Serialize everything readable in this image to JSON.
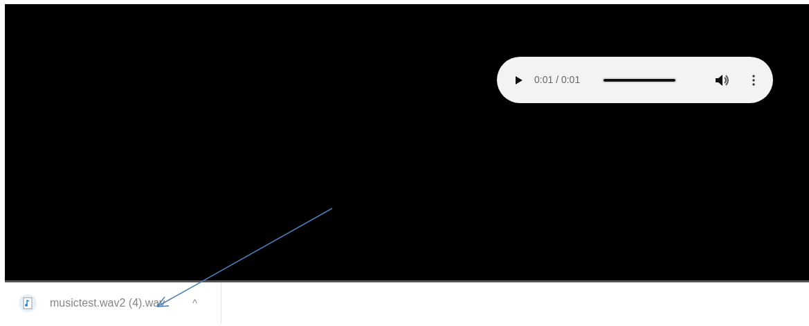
{
  "player": {
    "time": "0:01 / 0:01",
    "level": 1
  },
  "download": {
    "filename": "musictest.wav2 (4).wav",
    "caret": "^"
  }
}
